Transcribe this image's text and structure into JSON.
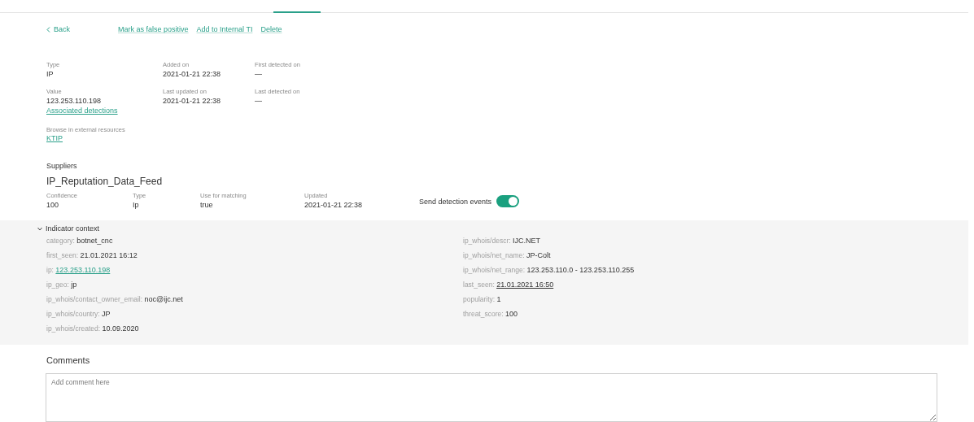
{
  "actions": {
    "back": "Back",
    "links": [
      "Mark as false positive",
      "Add to Internal TI",
      "Delete"
    ]
  },
  "fields": [
    {
      "label": "Type",
      "value": "IP"
    },
    {
      "label": "Added on",
      "value": "2021-01-21 22:38"
    },
    {
      "label": "First detected on",
      "value": "—"
    },
    {
      "label": "Value",
      "value": "123.253.110.198",
      "link": "Associated detections"
    },
    {
      "label": "Last updated on",
      "value": "2021-01-21 22:38"
    },
    {
      "label": "Last detected on",
      "value": "—"
    }
  ],
  "external": {
    "label": "Browse in external resources",
    "link": "KTIP"
  },
  "suppliers": {
    "heading": "Suppliers",
    "name": "IP_Reputation_Data_Feed",
    "columns": [
      {
        "label": "Confidence",
        "value": "100"
      },
      {
        "label": "Type",
        "value": "Ip"
      },
      {
        "label": "Use for matching",
        "value": "true"
      },
      {
        "label": "Updated",
        "value": "2021-01-21 22:38"
      }
    ],
    "toggle": {
      "label": "Send detection events",
      "on": true
    }
  },
  "context": {
    "title": "Indicator context",
    "expanded": true,
    "left": [
      {
        "key": "category:",
        "value": "botnet_cnc",
        "kind": "text"
      },
      {
        "key": "first_seen:",
        "value": "21.01.2021 16:12",
        "kind": "text"
      },
      {
        "key": "ip:",
        "value": "123.253.110.198",
        "kind": "link"
      },
      {
        "key": "ip_geo:",
        "value": "jp",
        "kind": "text"
      },
      {
        "key": "ip_whois/contact_owner_email:",
        "value": "noc@ijc.net",
        "kind": "text"
      },
      {
        "key": "ip_whois/country:",
        "value": "JP",
        "kind": "text"
      },
      {
        "key": "ip_whois/created:",
        "value": "10.09.2020",
        "kind": "text"
      }
    ],
    "right": [
      {
        "key": "ip_whois/descr:",
        "value": "IJC.NET",
        "kind": "text"
      },
      {
        "key": "ip_whois/net_name:",
        "value": "JP-Colt",
        "kind": "text"
      },
      {
        "key": "ip_whois/net_range:",
        "value": "123.253.110.0 - 123.253.110.255",
        "kind": "text"
      },
      {
        "key": "last_seen:",
        "value": "21.01.2021 16:50",
        "kind": "date"
      },
      {
        "key": "popularity:",
        "value": "1",
        "kind": "text"
      },
      {
        "key": "threat_score:",
        "value": "100",
        "kind": "text"
      }
    ]
  },
  "comments": {
    "heading": "Comments",
    "placeholder": "Add comment here"
  }
}
